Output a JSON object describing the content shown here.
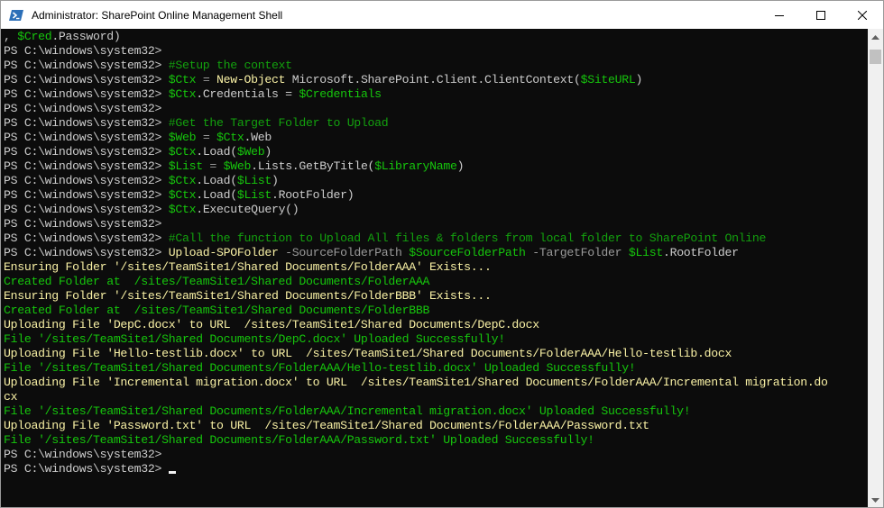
{
  "window": {
    "title": "Administrator: SharePoint Online Management Shell",
    "icon": "powershell-icon",
    "controls": [
      "minimize-icon",
      "maximize-icon",
      "close-icon"
    ]
  },
  "colors": {
    "console_bg": "#0c0c0c",
    "default_text": "#cccccc",
    "comment": "#13a10e",
    "variable": "#16c60c",
    "command": "#f9f1a5",
    "parameter": "#9a9a9a",
    "status_yellow": "#f9f1a5",
    "status_green": "#16c60c"
  },
  "console": {
    "cursor": "_",
    "lines": [
      [
        {
          "t": ", ",
          "c": "txt"
        },
        {
          "t": "$Cred",
          "c": "var"
        },
        {
          "t": ".Password)",
          "c": "txt"
        }
      ],
      [
        {
          "t": "PS C:\\windows\\system32> ",
          "c": "ps"
        }
      ],
      [
        {
          "t": "PS C:\\windows\\system32> ",
          "c": "ps"
        },
        {
          "t": "#Setup the context",
          "c": "cmt"
        }
      ],
      [
        {
          "t": "PS C:\\windows\\system32> ",
          "c": "ps"
        },
        {
          "t": "$Ctx",
          "c": "var"
        },
        {
          "t": " = ",
          "c": "op"
        },
        {
          "t": "New-Object",
          "c": "cmd"
        },
        {
          "t": " Microsoft.SharePoint.Client.ClientContext(",
          "c": "txt"
        },
        {
          "t": "$SiteURL",
          "c": "var"
        },
        {
          "t": ")",
          "c": "txt"
        }
      ],
      [
        {
          "t": "PS C:\\windows\\system32> ",
          "c": "ps"
        },
        {
          "t": "$Ctx",
          "c": "var"
        },
        {
          "t": ".Credentials = ",
          "c": "txt"
        },
        {
          "t": "$Credentials",
          "c": "var"
        }
      ],
      [
        {
          "t": "PS C:\\windows\\system32> ",
          "c": "ps"
        }
      ],
      [
        {
          "t": "PS C:\\windows\\system32> ",
          "c": "ps"
        },
        {
          "t": "#Get the Target Folder to Upload",
          "c": "cmt"
        }
      ],
      [
        {
          "t": "PS C:\\windows\\system32> ",
          "c": "ps"
        },
        {
          "t": "$Web",
          "c": "var"
        },
        {
          "t": " = ",
          "c": "op"
        },
        {
          "t": "$Ctx",
          "c": "var"
        },
        {
          "t": ".Web",
          "c": "txt"
        }
      ],
      [
        {
          "t": "PS C:\\windows\\system32> ",
          "c": "ps"
        },
        {
          "t": "$Ctx",
          "c": "var"
        },
        {
          "t": ".Load(",
          "c": "txt"
        },
        {
          "t": "$Web",
          "c": "var"
        },
        {
          "t": ")",
          "c": "txt"
        }
      ],
      [
        {
          "t": "PS C:\\windows\\system32> ",
          "c": "ps"
        },
        {
          "t": "$List",
          "c": "var"
        },
        {
          "t": " = ",
          "c": "op"
        },
        {
          "t": "$Web",
          "c": "var"
        },
        {
          "t": ".Lists.GetByTitle(",
          "c": "txt"
        },
        {
          "t": "$LibraryName",
          "c": "var"
        },
        {
          "t": ")",
          "c": "txt"
        }
      ],
      [
        {
          "t": "PS C:\\windows\\system32> ",
          "c": "ps"
        },
        {
          "t": "$Ctx",
          "c": "var"
        },
        {
          "t": ".Load(",
          "c": "txt"
        },
        {
          "t": "$List",
          "c": "var"
        },
        {
          "t": ")",
          "c": "txt"
        }
      ],
      [
        {
          "t": "PS C:\\windows\\system32> ",
          "c": "ps"
        },
        {
          "t": "$Ctx",
          "c": "var"
        },
        {
          "t": ".Load(",
          "c": "txt"
        },
        {
          "t": "$List",
          "c": "var"
        },
        {
          "t": ".RootFolder)",
          "c": "txt"
        }
      ],
      [
        {
          "t": "PS C:\\windows\\system32> ",
          "c": "ps"
        },
        {
          "t": "$Ctx",
          "c": "var"
        },
        {
          "t": ".ExecuteQuery()",
          "c": "txt"
        }
      ],
      [
        {
          "t": "PS C:\\windows\\system32> ",
          "c": "ps"
        }
      ],
      [
        {
          "t": "PS C:\\windows\\system32> ",
          "c": "ps"
        },
        {
          "t": "#Call the function to Upload All files & folders from local folder to SharePoint Online",
          "c": "cmt"
        }
      ],
      [
        {
          "t": "PS C:\\windows\\system32> ",
          "c": "ps"
        },
        {
          "t": "Upload-SPOFolder",
          "c": "cmd"
        },
        {
          "t": " -SourceFolderPath ",
          "c": "param"
        },
        {
          "t": "$SourceFolderPath",
          "c": "var"
        },
        {
          "t": " -TargetFolder ",
          "c": "param"
        },
        {
          "t": "$List",
          "c": "var"
        },
        {
          "t": ".RootFolder",
          "c": "txt"
        }
      ],
      [
        {
          "t": "Ensuring Folder '/sites/TeamSite1/Shared Documents/FolderAAA' Exists...",
          "c": "yellow"
        }
      ],
      [
        {
          "t": "Created Folder at  /sites/TeamSite1/Shared Documents/FolderAAA",
          "c": "green"
        }
      ],
      [
        {
          "t": "Ensuring Folder '/sites/TeamSite1/Shared Documents/FolderBBB' Exists...",
          "c": "yellow"
        }
      ],
      [
        {
          "t": "Created Folder at  /sites/TeamSite1/Shared Documents/FolderBBB",
          "c": "green"
        }
      ],
      [
        {
          "t": "Uploading File 'DepC.docx' to URL  /sites/TeamSite1/Shared Documents/DepC.docx",
          "c": "yellow"
        }
      ],
      [
        {
          "t": "File '/sites/TeamSite1/Shared Documents/DepC.docx' Uploaded Successfully!",
          "c": "green"
        }
      ],
      [
        {
          "t": "Uploading File 'Hello-testlib.docx' to URL  /sites/TeamSite1/Shared Documents/FolderAAA/Hello-testlib.docx",
          "c": "yellow"
        }
      ],
      [
        {
          "t": "File '/sites/TeamSite1/Shared Documents/FolderAAA/Hello-testlib.docx' Uploaded Successfully!",
          "c": "green"
        }
      ],
      [
        {
          "t": "Uploading File 'Incremental migration.docx' to URL  /sites/TeamSite1/Shared Documents/FolderAAA/Incremental migration.do",
          "c": "yellow"
        }
      ],
      [
        {
          "t": "cx",
          "c": "yellow"
        }
      ],
      [
        {
          "t": "File '/sites/TeamSite1/Shared Documents/FolderAAA/Incremental migration.docx' Uploaded Successfully!",
          "c": "green"
        }
      ],
      [
        {
          "t": "Uploading File 'Password.txt' to URL  /sites/TeamSite1/Shared Documents/FolderAAA/Password.txt",
          "c": "yellow"
        }
      ],
      [
        {
          "t": "File '/sites/TeamSite1/Shared Documents/FolderAAA/Password.txt' Uploaded Successfully!",
          "c": "green"
        }
      ],
      [
        {
          "t": "PS C:\\windows\\system32> ",
          "c": "ps"
        }
      ],
      [
        {
          "t": "PS C:\\windows\\system32> ",
          "c": "ps"
        },
        {
          "cursor": true
        }
      ]
    ]
  },
  "scrollbar": {
    "up": "scroll-up-arrow-icon",
    "down": "scroll-down-arrow-icon"
  }
}
